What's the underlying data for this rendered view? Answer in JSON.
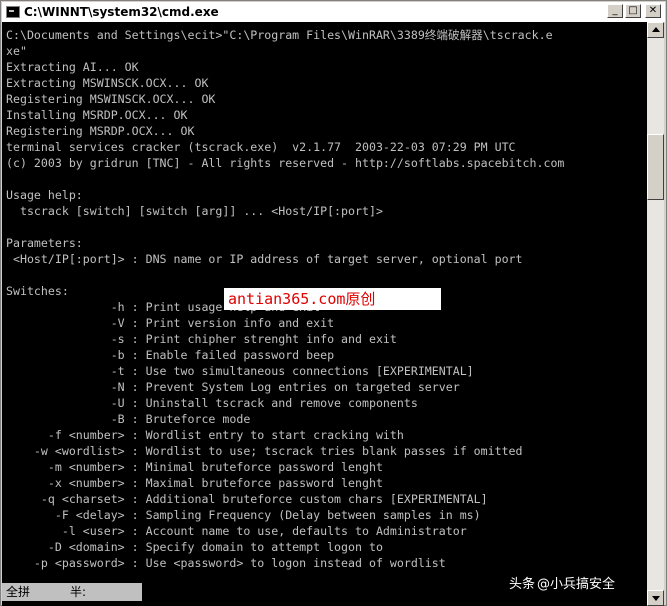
{
  "window": {
    "title": "C:\\WINNT\\system32\\cmd.exe",
    "controls": {
      "minimize": "_",
      "maximize": "□",
      "close": "✕"
    }
  },
  "console": {
    "lines": [
      "C:\\Documents and Settings\\ecit>\"C:\\Program Files\\WinRAR\\3389终端破解器\\tscrack.e",
      "xe\"",
      "Extracting AI... OK",
      "Extracting MSWINSCK.OCX... OK",
      "Registering MSWINSCK.OCX... OK",
      "Installing MSRDP.OCX... OK",
      "Registering MSRDP.OCX... OK",
      "terminal services cracker (tscrack.exe)  v2.1.77  2003-22-03 07:29 PM UTC",
      "(c) 2003 by gridrun [TNC] - All rights reserved - http://softlabs.spacebitch.com",
      "",
      "Usage help:",
      "  tscrack [switch] [switch [arg]] ... <Host/IP[:port]>",
      "",
      "Parameters:",
      " <Host/IP[:port]> : DNS name or IP address of target server, optional port",
      "",
      "Switches:",
      "               -h : Print usage help and exit",
      "               -V : Print version info and exit",
      "               -s : Print chipher strenght info and exit",
      "               -b : Enable failed password beep",
      "               -t : Use two simultaneous connections [EXPERIMENTAL]",
      "               -N : Prevent System Log entries on targeted server",
      "               -U : Uninstall tscrack and remove components",
      "               -B : Bruteforce mode",
      "      -f <number> : Wordlist entry to start cracking with",
      "    -w <wordlist> : Wordlist to use; tscrack tries blank passes if omitted",
      "      -m <number> : Minimal bruteforce password lenght",
      "      -x <number> : Maximal bruteforce password lenght",
      "     -q <charset> : Additional bruteforce custom chars [EXPERIMENTAL]",
      "       -F <delay> : Sampling Frequency (Delay between samples in ms)",
      "        -l <user> : Account name to use, defaults to Administrator",
      "      -D <domain> : Specify domain to attempt logon to",
      "    -p <password> : Use <password> to logon instead of wordlist"
    ]
  },
  "overlay": {
    "text": "antian365.com原创",
    "color": "#e00000"
  },
  "ime": {
    "mode": "全拼",
    "width": "半:"
  },
  "watermark": {
    "prefix": "头条",
    "handle": "@小兵搞安全"
  }
}
